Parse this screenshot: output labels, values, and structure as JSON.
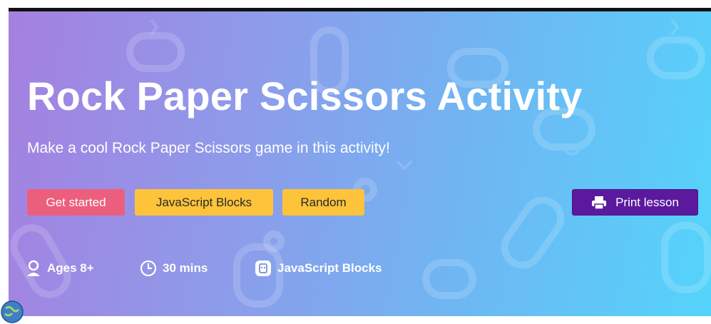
{
  "hero": {
    "title": "Rock Paper Scissors Activity",
    "subtitle": "Make a cool Rock Paper Scissors game in this activity!",
    "background_colors": [
      "#a580e0",
      "#54d4fb"
    ]
  },
  "buttons": {
    "get_started": "Get started",
    "javascript_blocks": "JavaScript Blocks",
    "random": "Random",
    "print_lesson": "Print lesson"
  },
  "meta": {
    "ages": "Ages 8+",
    "duration": "30 mins",
    "editor": "JavaScript Blocks"
  },
  "colors": {
    "get_started": "#ec5f7c",
    "yellow_buttons": "#fdc33b",
    "print_button": "#5b1a9e"
  },
  "icons": [
    "person-icon",
    "clock-icon",
    "editor-icon",
    "printer-icon",
    "globe-icon"
  ]
}
